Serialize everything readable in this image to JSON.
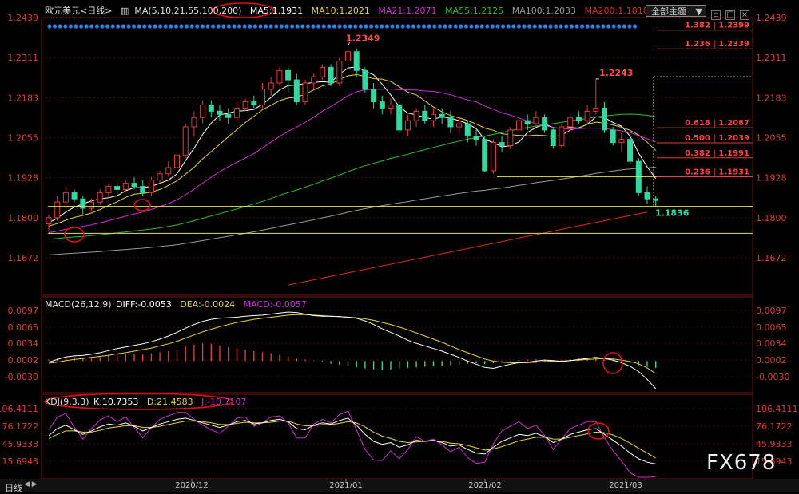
{
  "header": {
    "title": "欧元美元<日线>",
    "ma_label": "MA(5,10,21,55,100,200)",
    "ma5": "MA5:1.1931",
    "ma10": "MA10:1.2021",
    "ma21": "MA21:1.2071",
    "ma55": "MA55:1.2125",
    "ma100": "MA100:1.2033",
    "ma200": "MA200:1.1818",
    "theme_dropdown": "全部主题",
    "dropdown_arrow": "▼"
  },
  "colors": {
    "up": "#e23b3b",
    "down": "#35d6a0",
    "ma5": "#ffffff",
    "ma10": "#e8d23a",
    "ma21": "#d02bd6",
    "ma55": "#2bbd2b",
    "ma100": "#9a9a9a",
    "ma200": "#e02828",
    "axis_text": "#e23b3b",
    "grid": "#3a0f0f"
  },
  "main_panel": {
    "y_ticks": [
      "1.2439",
      "1.2311",
      "1.2183",
      "1.2055",
      "1.1928",
      "1.1800",
      "1.1672"
    ],
    "annotations": [
      "1.2349",
      "1.2243",
      "1.1836"
    ],
    "fib_levels": [
      "1.382 | 1.2399",
      "1.236 | 1.2339",
      "0.618 | 1.2087",
      "0.500 | 1.2039",
      "0.382 | 1.1991",
      "0.236 | 1.1931"
    ]
  },
  "macd_panel": {
    "label": "MACD(26,12,9)",
    "diff": "DIFF:-0.0053",
    "dea": "DEA:-0.0024",
    "macd": "MACD:-0.0057",
    "y_ticks": [
      "0.0097",
      "0.0065",
      "0.0034",
      "0.0002",
      "-0.0030"
    ]
  },
  "kdj_panel": {
    "label": "KDJ(9,3,3)",
    "k": "K:10.7353",
    "d": "D:21.4583",
    "j": "J:-10.7107",
    "y_ticks": [
      "106.4111",
      "76.1722",
      "45.9333",
      "15.6943"
    ]
  },
  "x_ticks": [
    "2020/12",
    "2021/01",
    "2021/02",
    "2021/03"
  ],
  "footer": {
    "tab": "日线",
    "watermark": "FX678"
  },
  "chart_data": {
    "type": "candlestick",
    "symbol": "EUR/USD",
    "ylim": [
      1.164,
      1.246
    ],
    "candles": [
      [
        1.178,
        1.18,
        1.1755,
        1.181
      ],
      [
        1.18,
        1.185,
        1.179,
        1.187
      ],
      [
        1.185,
        1.188,
        1.183,
        1.19
      ],
      [
        1.188,
        1.186,
        1.185,
        1.189
      ],
      [
        1.186,
        1.183,
        1.181,
        1.187
      ],
      [
        1.183,
        1.185,
        1.182,
        1.186
      ],
      [
        1.185,
        1.188,
        1.184,
        1.189
      ],
      [
        1.188,
        1.19,
        1.186,
        1.191
      ],
      [
        1.19,
        1.189,
        1.187,
        1.191
      ],
      [
        1.189,
        1.191,
        1.188,
        1.192
      ],
      [
        1.191,
        1.19,
        1.189,
        1.193
      ],
      [
        1.19,
        1.188,
        1.187,
        1.192
      ],
      [
        1.188,
        1.192,
        1.187,
        1.193
      ],
      [
        1.192,
        1.194,
        1.191,
        1.195
      ],
      [
        1.194,
        1.196,
        1.193,
        1.198
      ],
      [
        1.196,
        1.2,
        1.195,
        1.202
      ],
      [
        1.2,
        1.209,
        1.199,
        1.21
      ],
      [
        1.209,
        1.212,
        1.206,
        1.214
      ],
      [
        1.212,
        1.216,
        1.21,
        1.2175
      ],
      [
        1.216,
        1.214,
        1.212,
        1.2175
      ],
      [
        1.214,
        1.213,
        1.211,
        1.216
      ],
      [
        1.213,
        1.212,
        1.21,
        1.215
      ],
      [
        1.212,
        1.215,
        1.211,
        1.217
      ],
      [
        1.215,
        1.217,
        1.214,
        1.218
      ],
      [
        1.217,
        1.216,
        1.215,
        1.219
      ],
      [
        1.216,
        1.221,
        1.215,
        1.223
      ],
      [
        1.221,
        1.223,
        1.219,
        1.225
      ],
      [
        1.223,
        1.227,
        1.222,
        1.228
      ],
      [
        1.227,
        1.224,
        1.22,
        1.228
      ],
      [
        1.224,
        1.217,
        1.216,
        1.226
      ],
      [
        1.217,
        1.223,
        1.216,
        1.224
      ],
      [
        1.223,
        1.225,
        1.221,
        1.226
      ],
      [
        1.225,
        1.228,
        1.224,
        1.229
      ],
      [
        1.228,
        1.223,
        1.222,
        1.229
      ],
      [
        1.223,
        1.23,
        1.222,
        1.231
      ],
      [
        1.23,
        1.233,
        1.229,
        1.2349
      ],
      [
        1.233,
        1.227,
        1.225,
        1.234
      ],
      [
        1.227,
        1.221,
        1.22,
        1.228
      ],
      [
        1.221,
        1.217,
        1.215,
        1.223
      ],
      [
        1.217,
        1.215,
        1.213,
        1.219
      ],
      [
        1.215,
        1.216,
        1.213,
        1.218
      ],
      [
        1.216,
        1.208,
        1.207,
        1.217
      ],
      [
        1.208,
        1.211,
        1.206,
        1.213
      ],
      [
        1.211,
        1.214,
        1.209,
        1.215
      ],
      [
        1.214,
        1.211,
        1.21,
        1.216
      ],
      [
        1.211,
        1.213,
        1.209,
        1.215
      ],
      [
        1.213,
        1.212,
        1.21,
        1.215
      ],
      [
        1.212,
        1.209,
        1.207,
        1.214
      ],
      [
        1.209,
        1.21,
        1.207,
        1.212
      ],
      [
        1.21,
        1.206,
        1.204,
        1.211
      ],
      [
        1.206,
        1.205,
        1.203,
        1.208
      ],
      [
        1.205,
        1.195,
        1.1945,
        1.206
      ],
      [
        1.195,
        1.204,
        1.194,
        1.205
      ],
      [
        1.204,
        1.203,
        1.201,
        1.206
      ],
      [
        1.203,
        1.208,
        1.202,
        1.209
      ],
      [
        1.208,
        1.211,
        1.207,
        1.212
      ],
      [
        1.211,
        1.21,
        1.208,
        1.213
      ],
      [
        1.21,
        1.212,
        1.209,
        1.214
      ],
      [
        1.212,
        1.208,
        1.207,
        1.213
      ],
      [
        1.208,
        1.203,
        1.202,
        1.209
      ],
      [
        1.203,
        1.209,
        1.202,
        1.21
      ],
      [
        1.209,
        1.212,
        1.208,
        1.213
      ],
      [
        1.212,
        1.211,
        1.21,
        1.214
      ],
      [
        1.211,
        1.214,
        1.21,
        1.216
      ],
      [
        1.214,
        1.215,
        1.213,
        1.2243
      ],
      [
        1.215,
        1.208,
        1.207,
        1.217
      ],
      [
        1.208,
        1.204,
        1.203,
        1.209
      ],
      [
        1.204,
        1.205,
        1.201,
        1.207
      ],
      [
        1.205,
        1.198,
        1.197,
        1.206
      ],
      [
        1.198,
        1.188,
        1.187,
        1.199
      ],
      [
        1.188,
        1.186,
        1.1845,
        1.19
      ],
      [
        1.186,
        1.1855,
        1.1836,
        1.187
      ]
    ],
    "macd_hist": [
      0.0003,
      0.0006,
      0.0009,
      0.0008,
      0.0007,
      0.0008,
      0.001,
      0.0012,
      0.0013,
      0.0014,
      0.0014,
      0.0013,
      0.0015,
      0.0017,
      0.0019,
      0.0022,
      0.0028,
      0.0032,
      0.0034,
      0.0033,
      0.003,
      0.0027,
      0.0024,
      0.0022,
      0.0019,
      0.0017,
      0.0015,
      0.0012,
      0.0009,
      0.0005,
      0.0003,
      0.0001,
      -0.0002,
      -0.0005,
      -0.0007,
      -0.0009,
      -0.0012,
      -0.0014,
      -0.0016,
      -0.0018,
      -0.0016,
      -0.0014,
      -0.0013,
      -0.0012,
      -0.0011,
      -0.001,
      -0.0009,
      -0.0008,
      -0.0006,
      -0.0005,
      -0.0004,
      -0.0006,
      -0.0004,
      -0.0002,
      0.0001,
      0.0002,
      0.0003,
      0.0004,
      0.0003,
      0.0002,
      0.0003,
      0.0004,
      0.0005,
      0.0006,
      0.0006,
      0.0005,
      0.0002,
      -0.0001,
      -0.0004,
      -0.0008,
      -0.0011,
      -0.0013
    ],
    "macd_diff": [
      -0.0002,
      0.0003,
      0.0008,
      0.001,
      0.0011,
      0.0013,
      0.0016,
      0.002,
      0.0024,
      0.0027,
      0.003,
      0.0033,
      0.0037,
      0.0042,
      0.0048,
      0.0055,
      0.0063,
      0.007,
      0.0076,
      0.008,
      0.0082,
      0.0083,
      0.0084,
      0.0086,
      0.0087,
      0.0088,
      0.009,
      0.0092,
      0.0094,
      0.0093,
      0.009,
      0.0087,
      0.0086,
      0.0086,
      0.0085,
      0.0084,
      0.0082,
      0.0077,
      0.007,
      0.0062,
      0.0055,
      0.0048,
      0.004,
      0.0034,
      0.0029,
      0.0024,
      0.0019,
      0.0013,
      0.0007,
      0.0,
      -0.0006,
      -0.0012,
      -0.0014,
      -0.001,
      -0.0006,
      -0.0003,
      -0.0002,
      0.0,
      0.0002,
      0.0001,
      -0.0001,
      0.0001,
      0.0003,
      0.0005,
      0.0007,
      0.0005,
      0.0002,
      -0.0003,
      -0.001,
      -0.002,
      -0.0035,
      -0.0053
    ],
    "macd_dea": [
      -0.0004,
      -0.0002,
      0.0001,
      0.0003,
      0.0005,
      0.0007,
      0.0009,
      0.0011,
      0.0014,
      0.0016,
      0.0019,
      0.0022,
      0.0025,
      0.0029,
      0.0033,
      0.0038,
      0.0044,
      0.005,
      0.0056,
      0.0061,
      0.0066,
      0.007,
      0.0074,
      0.0077,
      0.008,
      0.0082,
      0.0084,
      0.0086,
      0.0088,
      0.0089,
      0.0089,
      0.0088,
      0.0087,
      0.0086,
      0.0085,
      0.0084,
      0.0083,
      0.0081,
      0.0078,
      0.0074,
      0.007,
      0.0065,
      0.006,
      0.0054,
      0.0048,
      0.0042,
      0.0036,
      0.0029,
      0.0022,
      0.0016,
      0.001,
      0.0004,
      0.0,
      -0.0002,
      -0.0003,
      -0.0003,
      -0.0003,
      -0.0002,
      -0.0001,
      0.0,
      0.0,
      0.0001,
      0.0002,
      0.0003,
      0.0004,
      0.0005,
      0.0004,
      0.0002,
      -0.0001,
      -0.0005,
      -0.0013,
      -0.0024
    ],
    "kdj_k": [
      60,
      72,
      78,
      70,
      62,
      68,
      75,
      80,
      78,
      82,
      76,
      68,
      74,
      80,
      84,
      88,
      90,
      86,
      82,
      78,
      74,
      78,
      84,
      86,
      80,
      82,
      86,
      88,
      84,
      72,
      70,
      78,
      82,
      80,
      86,
      90,
      78,
      62,
      50,
      45,
      48,
      40,
      44,
      52,
      50,
      52,
      48,
      42,
      44,
      36,
      30,
      28,
      40,
      50,
      56,
      62,
      60,
      64,
      58,
      48,
      54,
      62,
      66,
      70,
      72,
      62,
      52,
      42,
      30,
      20,
      14,
      11
    ],
    "kdj_d": [
      55,
      62,
      68,
      68,
      66,
      66,
      69,
      73,
      75,
      77,
      77,
      74,
      74,
      76,
      79,
      82,
      85,
      85,
      84,
      82,
      79,
      79,
      81,
      83,
      82,
      82,
      83,
      85,
      85,
      80,
      77,
      77,
      79,
      79,
      81,
      84,
      82,
      75,
      66,
      59,
      55,
      50,
      48,
      49,
      50,
      51,
      50,
      47,
      46,
      43,
      39,
      35,
      37,
      41,
      46,
      51,
      54,
      57,
      57,
      54,
      54,
      57,
      60,
      63,
      66,
      65,
      61,
      55,
      47,
      38,
      30,
      21
    ],
    "kdj_j": [
      70,
      92,
      98,
      74,
      54,
      72,
      87,
      94,
      84,
      92,
      74,
      56,
      74,
      88,
      94,
      100,
      100,
      88,
      78,
      70,
      64,
      76,
      90,
      92,
      76,
      82,
      92,
      94,
      82,
      56,
      56,
      80,
      88,
      82,
      96,
      102,
      70,
      36,
      18,
      17,
      34,
      20,
      36,
      58,
      50,
      54,
      44,
      32,
      40,
      22,
      12,
      14,
      46,
      68,
      76,
      84,
      72,
      78,
      60,
      36,
      54,
      72,
      78,
      84,
      84,
      56,
      34,
      16,
      -4,
      -16,
      -18,
      -11
    ],
    "fib_values": [
      1.2399,
      1.2339,
      1.2087,
      1.2039,
      1.1991,
      1.1931
    ],
    "support_lines": [
      1.1836,
      1.175
    ],
    "ma_values": {
      "MA5": 1.1931,
      "MA10": 1.2021,
      "MA21": 1.2071,
      "MA55": 1.2125,
      "MA100": 1.2033,
      "MA200": 1.1818
    }
  }
}
